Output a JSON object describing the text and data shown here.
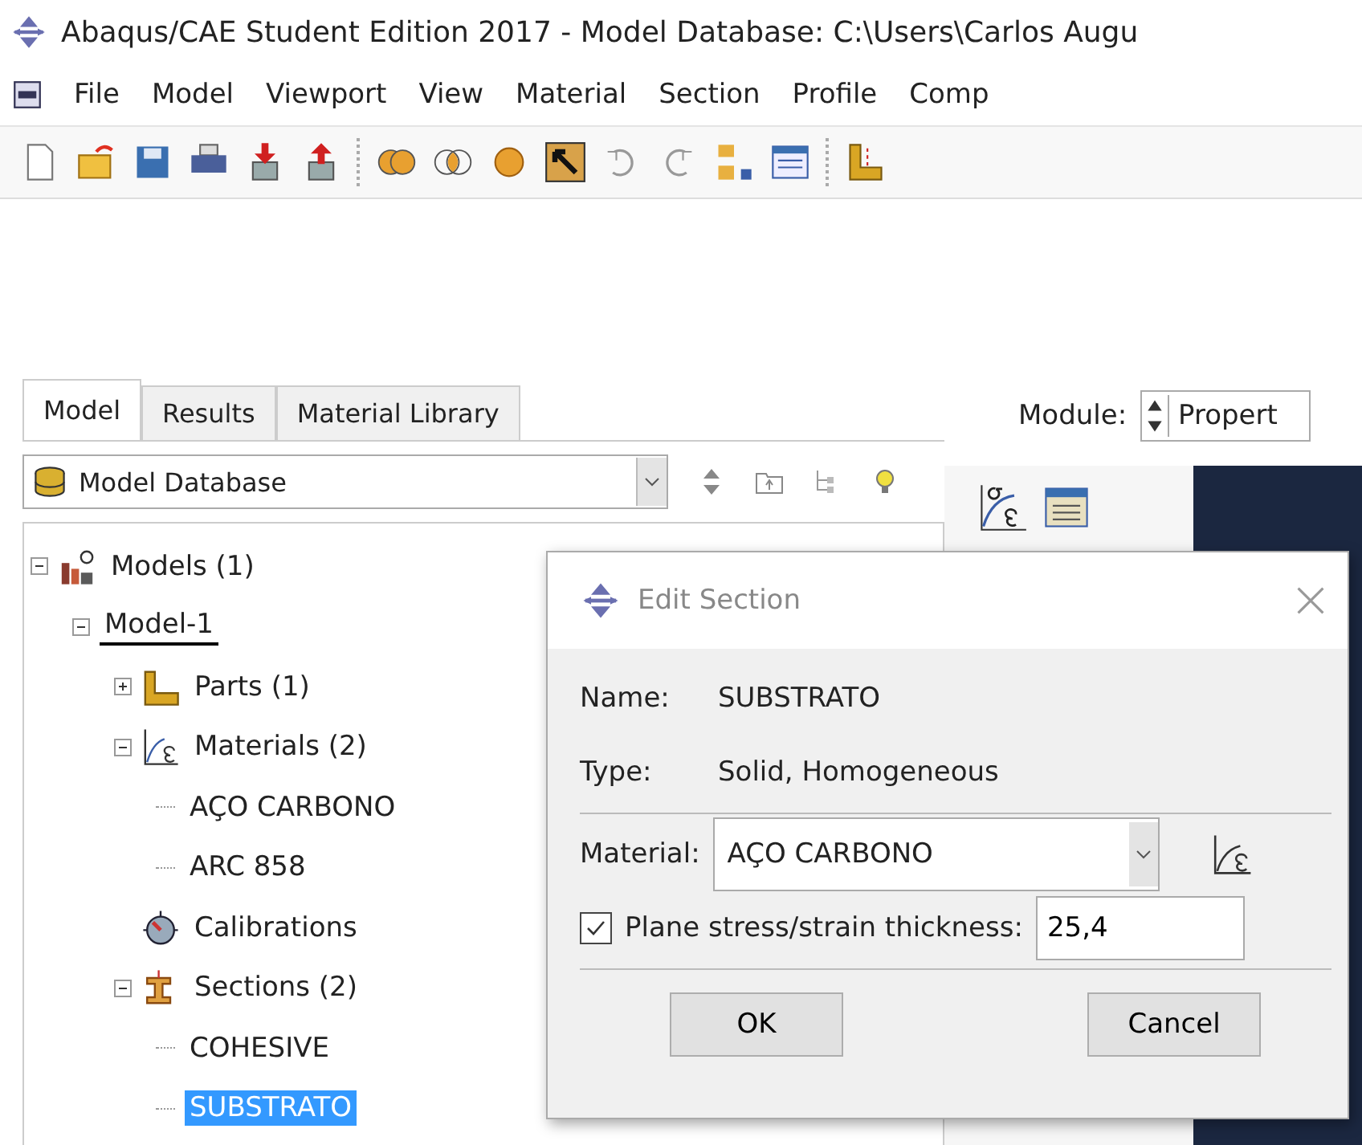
{
  "window": {
    "title": "Abaqus/CAE Student Edition 2017 - Model Database: C:\\Users\\Carlos Augu"
  },
  "menu": [
    "File",
    "Model",
    "Viewport",
    "View",
    "Material",
    "Section",
    "Profile",
    "Comp"
  ],
  "tabs": [
    {
      "label": "Model",
      "selected": true
    },
    {
      "label": "Results",
      "selected": false
    },
    {
      "label": "Material Library",
      "selected": false
    }
  ],
  "database_combo": {
    "value": "Model Database"
  },
  "module": {
    "label": "Module:",
    "value": "Propert"
  },
  "tree": [
    {
      "label": "Models (1)",
      "kind": "models",
      "expanded": true,
      "current": false,
      "selected": false,
      "children": [
        {
          "label": "Model-1",
          "expanded": true,
          "current": true,
          "selected": false,
          "children": [
            {
              "label": "Parts (1)",
              "kind": "parts",
              "expanded": false,
              "current": false,
              "selected": false
            },
            {
              "label": "Materials (2)",
              "kind": "materials",
              "expanded": true,
              "current": false,
              "selected": false,
              "children": [
                {
                  "label": "AÇO CARBONO",
                  "kind": "leaf",
                  "current": false,
                  "selected": false
                },
                {
                  "label": "ARC 858",
                  "kind": "leaf",
                  "current": false,
                  "selected": false
                }
              ]
            },
            {
              "label": "Calibrations",
              "kind": "calibrations",
              "current": false,
              "selected": false
            },
            {
              "label": "Sections (2)",
              "kind": "sections",
              "expanded": true,
              "current": false,
              "selected": false,
              "children": [
                {
                  "label": "COHESIVE",
                  "kind": "leaf",
                  "current": false,
                  "selected": false
                },
                {
                  "label": "SUBSTRATO",
                  "kind": "leaf",
                  "current": false,
                  "selected": true
                }
              ]
            }
          ]
        }
      ]
    }
  ],
  "dialog": {
    "title": "Edit Section",
    "name_label": "Name:",
    "name": "SUBSTRATO",
    "type_label": "Type:",
    "type": "Solid, Homogeneous",
    "material_label": "Material:",
    "material": "AÇO CARBONO",
    "thickness_checked": true,
    "thickness_label": "Plane stress/strain thickness:",
    "thickness": "25,4",
    "buttons": [
      "OK",
      "Cancel"
    ]
  }
}
